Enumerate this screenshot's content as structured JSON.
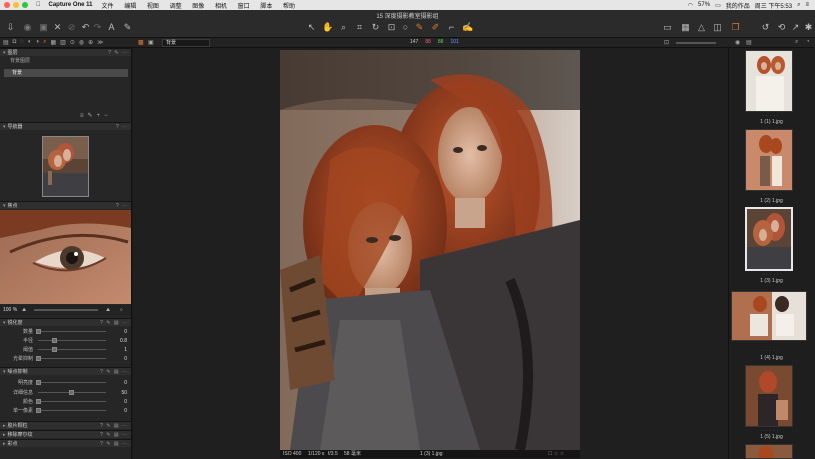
{
  "menubar": {
    "app_name": "Capture One 11",
    "items": [
      "文件",
      "编辑",
      "视图",
      "调整",
      "图像",
      "相机",
      "窗口",
      "脚本",
      "帮助"
    ],
    "status": {
      "battery": "57%",
      "clock": "周三 下午5:53",
      "user_label": "我的作品"
    }
  },
  "window": {
    "title": "15 深度摄影教室摄影组"
  },
  "subbar": {
    "preset_name": "背景",
    "cursor_readout": [
      "147",
      "88",
      "88",
      "101"
    ]
  },
  "left_panel": {
    "sections": [
      {
        "title": "图层",
        "sub": "背景图层",
        "layer_name": "背景"
      },
      {
        "title": "导航器"
      },
      {
        "title": "焦点"
      },
      {
        "title": "锐化度",
        "rows": [
          {
            "label": "数量",
            "value": "0"
          },
          {
            "label": "半径",
            "value": "0.8"
          },
          {
            "label": "阈值",
            "value": "1"
          },
          {
            "label": "光晕抑制",
            "value": "0"
          }
        ]
      },
      {
        "title": "噪点抑制",
        "rows": [
          {
            "label": "明亮度",
            "value": "0"
          },
          {
            "label": "详细信息",
            "value": "50"
          },
          {
            "label": "颜色",
            "value": "0"
          },
          {
            "label": "单一像素",
            "value": "0"
          }
        ]
      },
      {
        "title": "胶片颗粒"
      },
      {
        "title": "移除摩尔纹"
      },
      {
        "title": "彩点"
      }
    ],
    "zoom_label": "100 %"
  },
  "viewer": {
    "status": {
      "iso": "ISO 400",
      "shutter": "1/120 s",
      "aperture": "f/3.5",
      "focal": "58 毫米",
      "filename": "1 (3) 1.jpg"
    }
  },
  "browser": {
    "thumbs": [
      {
        "label": "1 (1) 1.jpg",
        "selected": false
      },
      {
        "label": "1 (2) 1.jpg",
        "selected": false
      },
      {
        "label": "1 (3) 1.jpg",
        "selected": true
      },
      {
        "label": "1 (4) 1.jpg",
        "selected": false
      },
      {
        "label": "1 (5) 1.jpg",
        "selected": false
      },
      {
        "label": "",
        "selected": false
      }
    ]
  },
  "colors": {
    "selection": "#e8e8e8",
    "panel": "#262626",
    "accent_orange": "#e07a2b"
  }
}
